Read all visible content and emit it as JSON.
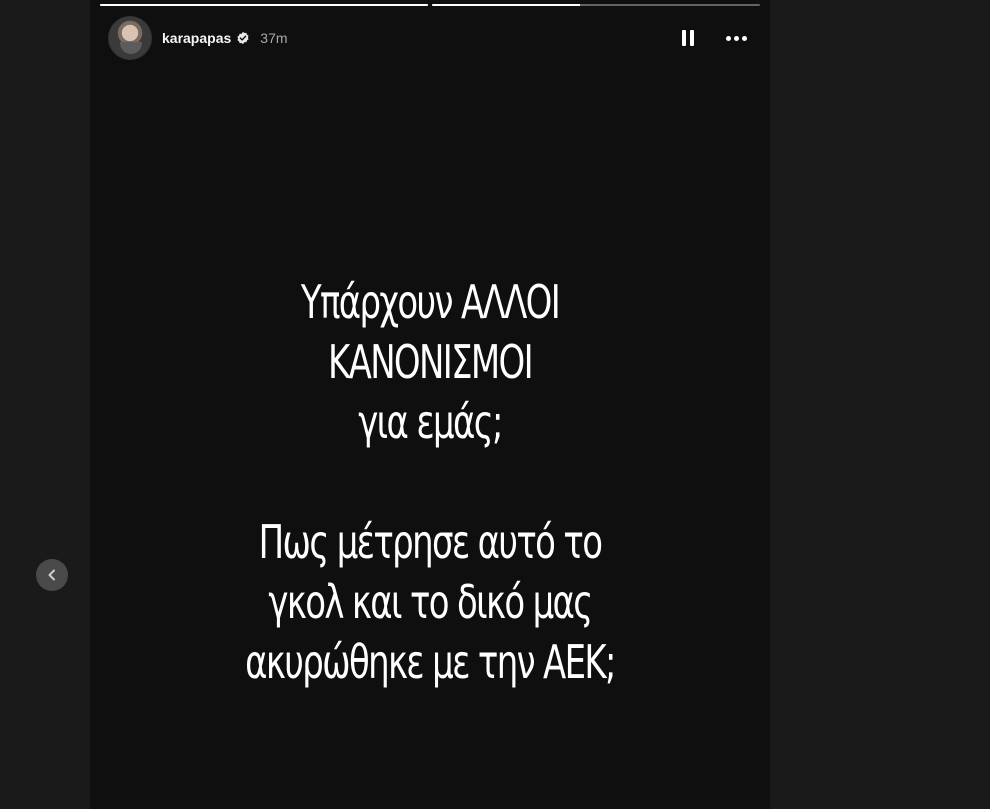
{
  "story": {
    "username": "karapapas",
    "timestamp": "37m",
    "verified": true,
    "progress": [
      1.0,
      0.45
    ],
    "text_lines": [
      "Υπάρχουν ΑΛΛΟΙ",
      "ΚΑΝΟΝΙΣΜΟΙ",
      "για εμάς;",
      "",
      "Πως μέτρησε αυτό το",
      "γκολ και το δικό μας",
      "ακυρώθηκε με την ΑΕΚ;"
    ]
  },
  "icons": {
    "avatar": "profile-avatar",
    "verified": "verified-badge-icon",
    "pause": "pause-icon",
    "more": "more-horizontal-icon",
    "previous": "chevron-left-icon"
  },
  "colors": {
    "background": "#1a1a1a",
    "story_background": "#0f0f0f",
    "text": "#ffffff",
    "secondary_text": "#a8a8a8",
    "nav_button": "#4a4a4a"
  }
}
